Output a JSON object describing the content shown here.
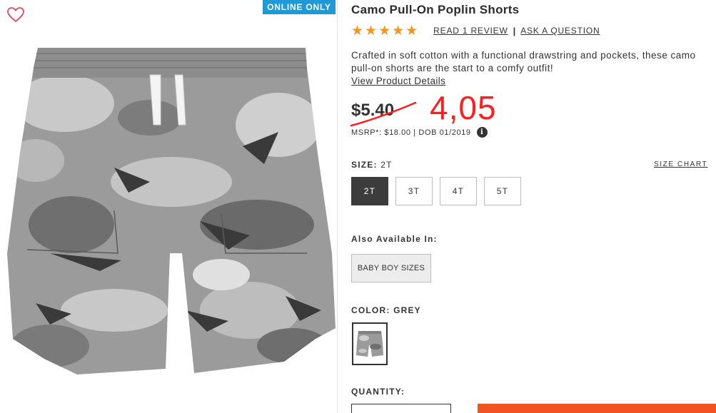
{
  "badge": {
    "online_only": "ONLINE ONLY"
  },
  "icons": {
    "favorite": "heart-outline-icon",
    "info": "info-circle-icon"
  },
  "product": {
    "title": "Camo Pull-On Poplin Shorts",
    "rating": 5,
    "rating_stars": "★★★★★",
    "review_link": "READ 1 REVIEW",
    "separator": "|",
    "question_link": "ASK A QUESTION",
    "description": "Crafted in soft cotton with a functional drawstring and pockets, these camo pull-on shorts are the start to a comfy outfit!",
    "details_link": "View Product Details"
  },
  "pricing": {
    "old_price": "$5.40",
    "new_price_handwritten": "4,05",
    "msrp": "MSRP*: $18.00 | DOB 01/2019",
    "info_glyph": "i"
  },
  "size": {
    "label": "SIZE:",
    "selected": "2T",
    "chart_link": "SIZE CHART",
    "options": [
      "2T",
      "3T",
      "4T",
      "5T"
    ]
  },
  "also_available": {
    "label": "Also Available In:",
    "option": "BABY BOY SIZES"
  },
  "color": {
    "label": "COLOR:",
    "selected": "GREY"
  },
  "quantity": {
    "label": "QUANTITY:"
  },
  "colors": {
    "badge_blue": "#1f9ad6",
    "star_orange": "#f7941d",
    "handwritten_red": "#ff1f1f",
    "add_button_orange": "#f05423",
    "selected_size": "#3c3c3c"
  }
}
